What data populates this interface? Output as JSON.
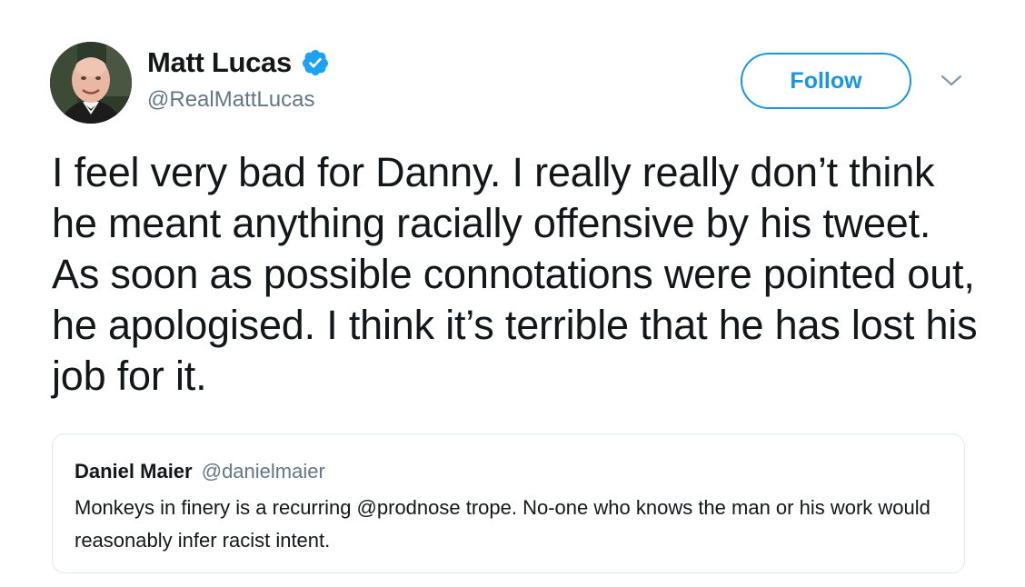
{
  "author": {
    "display_name": "Matt Lucas",
    "handle": "@RealMattLucas",
    "verified": true
  },
  "actions": {
    "follow_label": "Follow"
  },
  "tweet": {
    "text": "I feel very bad for Danny. I really really don’t think he meant anything racially offensive by his tweet. As soon as possible connotations were pointed out, he apologised. I think it’s terrible that he has lost his job for it."
  },
  "quoted_tweet": {
    "display_name": "Daniel Maier",
    "handle": "@danielmaier",
    "text": "Monkeys in finery is a recurring @prodnose trope. No-one who knows the man or his work would reasonably infer racist intent."
  },
  "icons": {
    "verified": "verified-badge-icon",
    "caret": "chevron-down-icon"
  },
  "colors": {
    "accent": "#1b95e0",
    "text_primary": "#14171a",
    "text_secondary": "#657786",
    "border": "#e1e8ed"
  }
}
